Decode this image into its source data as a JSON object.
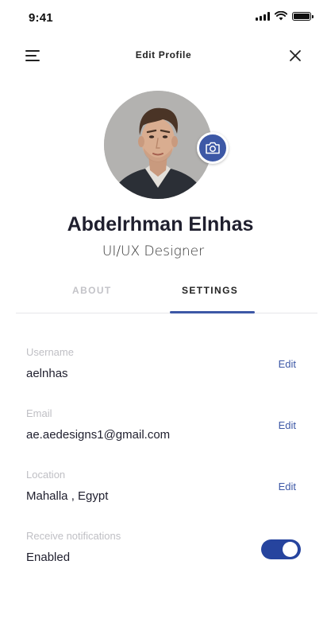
{
  "status_bar": {
    "time": "9:41",
    "icons": [
      "cellular-signal-icon",
      "wifi-icon",
      "battery-icon"
    ]
  },
  "header": {
    "title": "Edit Profile",
    "menu_icon": "menu-icon",
    "close_icon": "close-icon"
  },
  "profile": {
    "name": "Abdelrhman Elnhas",
    "role": "UI/UX Designer",
    "camera_icon": "camera-icon"
  },
  "tabs": [
    {
      "label": "ABOUT",
      "active": false
    },
    {
      "label": "SETTINGS",
      "active": true
    }
  ],
  "fields": [
    {
      "label": "Username",
      "value": "aelnhas",
      "action": "Edit"
    },
    {
      "label": "Email",
      "value": "ae.aedesigns1@gmail.com",
      "action": "Edit"
    },
    {
      "label": "Location",
      "value": "Mahalla , Egypt",
      "action": "Edit"
    }
  ],
  "notifications": {
    "label": "Receive notifications",
    "value": "Enabled",
    "on": true
  },
  "colors": {
    "accent": "#3d58a6",
    "toggle_on": "#26449e",
    "label_gray": "#bfbfc4",
    "text_dark": "#1f1f2e"
  }
}
